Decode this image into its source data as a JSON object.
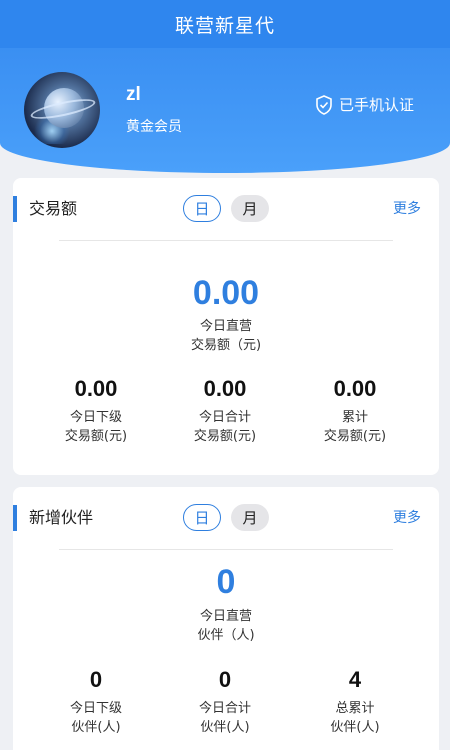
{
  "app": {
    "title": "联营新星代"
  },
  "profile": {
    "username": "zl",
    "level": "黄金会员",
    "verified_text": "已手机认证"
  },
  "transaction": {
    "title": "交易额",
    "tab_day": "日",
    "tab_month": "月",
    "more": "更多",
    "main_value": "0.00",
    "main_label_1": "今日直营",
    "main_label_2": "交易额（元)",
    "stats": [
      {
        "value": "0.00",
        "label_1": "今日下级",
        "label_2": "交易额(元)"
      },
      {
        "value": "0.00",
        "label_1": "今日合计",
        "label_2": "交易额(元)"
      },
      {
        "value": "0.00",
        "label_1": "累计",
        "label_2": "交易额(元)"
      }
    ]
  },
  "partners": {
    "title": "新增伙伴",
    "tab_day": "日",
    "tab_month": "月",
    "more": "更多",
    "main_value": "0",
    "main_label_1": "今日直营",
    "main_label_2": "伙伴（人)",
    "stats": [
      {
        "value": "0",
        "label_1": "今日下级",
        "label_2": "伙伴(人)"
      },
      {
        "value": "0",
        "label_1": "今日合计",
        "label_2": "伙伴(人)"
      },
      {
        "value": "4",
        "label_1": "总累计",
        "label_2": "伙伴(人)"
      }
    ]
  },
  "colors": {
    "accent": "#2f7fdf",
    "header": "#2f86ee"
  }
}
